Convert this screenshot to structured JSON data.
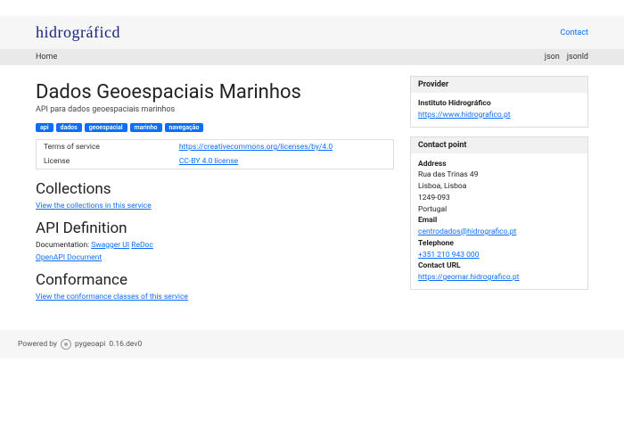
{
  "header": {
    "brand": "hidrográficd",
    "contact": "Contact"
  },
  "nav": {
    "home": "Home",
    "formats": [
      "json",
      "jsonld"
    ]
  },
  "page": {
    "title": "Dados Geoespaciais Marinhos",
    "subtitle": "API para dados geoespaciais marinhos",
    "tags": [
      "api",
      "dados",
      "geoespacial",
      "marinho",
      "navegação"
    ],
    "terms_label": "Terms of service",
    "terms_link": "https://creativecommons.org/licenses/by/4.0",
    "license_label": "License",
    "license_link": "CC-BY 4.0 license"
  },
  "collections": {
    "heading": "Collections",
    "link": "View the collections in this service"
  },
  "apidef": {
    "heading": "API Definition",
    "doc_label": "Documentation:",
    "swagger": "Swagger UI",
    "redoc": "ReDoc",
    "openapi": "OpenAPI Document"
  },
  "conformance": {
    "heading": "Conformance",
    "link": "View the conformance classes of this service"
  },
  "provider": {
    "heading": "Provider",
    "name": "Instituto Hidrográfico",
    "url": "https://www.hidrografico.pt"
  },
  "contact": {
    "heading": "Contact point",
    "address_label": "Address",
    "address_lines": [
      "Rua das Trinas 49",
      "Lisboa, Lisboa",
      "1249-093",
      "Portugal"
    ],
    "email_label": "Email",
    "email": "centrodados@hidrografico.pt",
    "tel_label": "Telephone",
    "tel": "+351 210 943 000",
    "url_label": "Contact URL",
    "url": "https://geomar.hidrografico.pt"
  },
  "footer": {
    "powered": "Powered by",
    "product": "pygeoapi",
    "version": "0.16.dev0"
  }
}
